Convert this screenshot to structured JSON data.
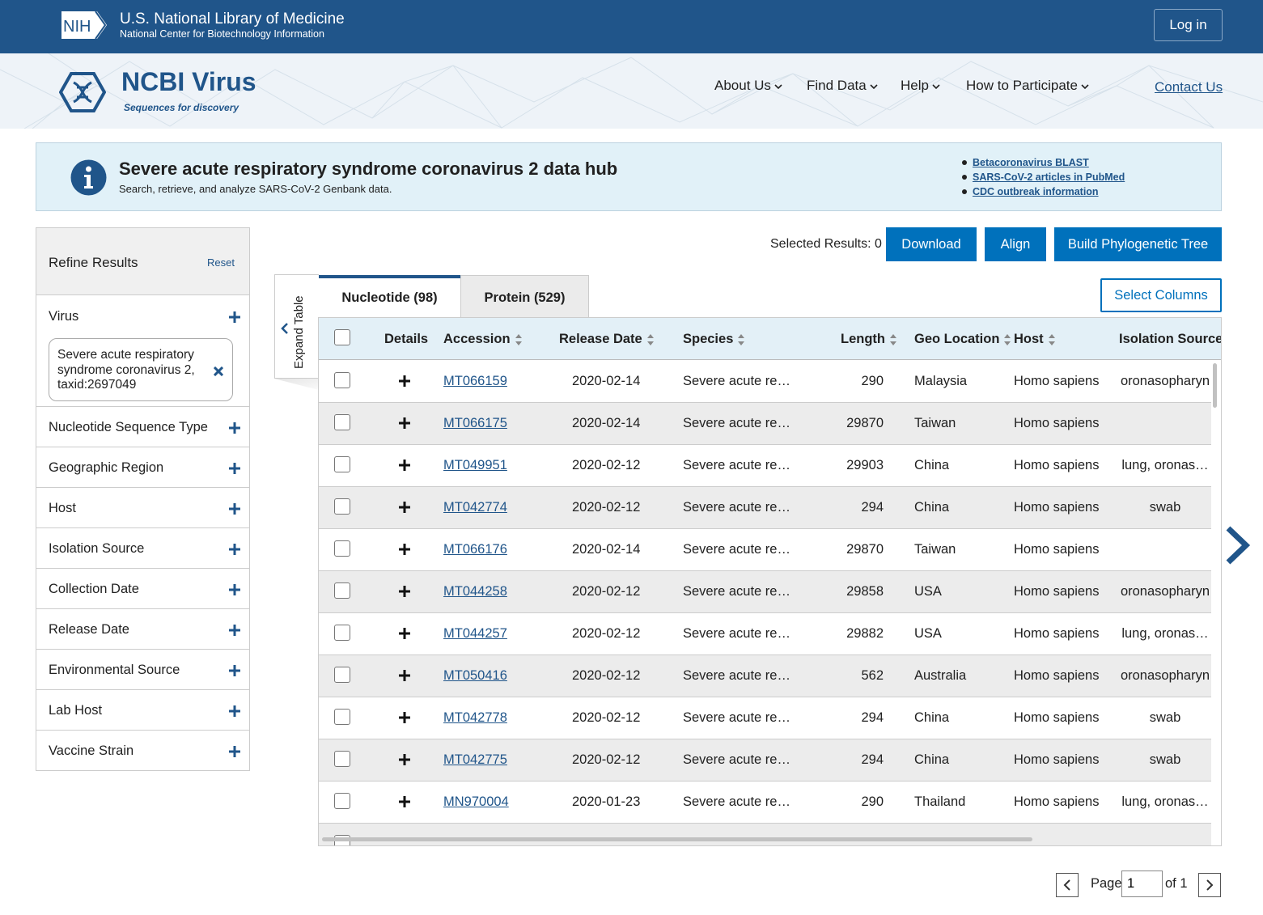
{
  "nih": {
    "logo_text": "NIH",
    "title": "U.S. National Library of Medicine",
    "subtitle": "National Center for Biotechnology Information",
    "login_label": "Log in"
  },
  "site": {
    "name": "NCBI Virus",
    "tagline": "Sequences for discovery",
    "nav": [
      "About Us",
      "Find Data",
      "Help",
      "How to Participate"
    ],
    "contact_label": "Contact Us"
  },
  "banner": {
    "title": "Severe acute respiratory syndrome coronavirus 2 data hub",
    "subtitle": "Search, retrieve, and analyze SARS-CoV-2 Genbank data.",
    "links": [
      "Betacoronavirus BLAST",
      "SARS-CoV-2 articles in PubMed",
      "CDC outbreak information"
    ]
  },
  "sidebar": {
    "title": "Refine Results",
    "reset_label": "Reset",
    "virus_label": "Virus",
    "virus_chip": "Severe acute respiratory syndrome coronavirus 2, taxid:2697049",
    "facets": [
      "Nucleotide Sequence Type",
      "Geographic Region",
      "Host",
      "Isolation Source",
      "Collection Date",
      "Release Date",
      "Environmental Source",
      "Lab Host",
      "Vaccine Strain"
    ]
  },
  "toolbar": {
    "selected_results": "Selected Results: 0",
    "download_label": "Download",
    "align_label": "Align",
    "tree_label": "Build Phylogenetic Tree",
    "select_columns_label": "Select Columns",
    "expand_table_label": "Expand Table"
  },
  "tabs": [
    {
      "label": "Nucleotide (98)",
      "active": true
    },
    {
      "label": "Protein (529)",
      "active": false
    }
  ],
  "table": {
    "columns": [
      "Details",
      "Accession",
      "Release Date",
      "Species",
      "Length",
      "Geo Location",
      "Host",
      "Isolation Source"
    ],
    "rows": [
      {
        "accession": "MT066159",
        "release_date": "2020-02-14",
        "species": "Severe acute re…",
        "length": "290",
        "geo": "Malaysia",
        "host": "Homo sapiens",
        "isolation": "oronasopharyn"
      },
      {
        "accession": "MT066175",
        "release_date": "2020-02-14",
        "species": "Severe acute re…",
        "length": "29870",
        "geo": "Taiwan",
        "host": "Homo sapiens",
        "isolation": ""
      },
      {
        "accession": "MT049951",
        "release_date": "2020-02-12",
        "species": "Severe acute re…",
        "length": "29903",
        "geo": "China",
        "host": "Homo sapiens",
        "isolation": "lung, oronas…"
      },
      {
        "accession": "MT042774",
        "release_date": "2020-02-12",
        "species": "Severe acute re…",
        "length": "294",
        "geo": "China",
        "host": "Homo sapiens",
        "isolation": "swab"
      },
      {
        "accession": "MT066176",
        "release_date": "2020-02-14",
        "species": "Severe acute re…",
        "length": "29870",
        "geo": "Taiwan",
        "host": "Homo sapiens",
        "isolation": ""
      },
      {
        "accession": "MT044258",
        "release_date": "2020-02-12",
        "species": "Severe acute re…",
        "length": "29858",
        "geo": "USA",
        "host": "Homo sapiens",
        "isolation": "oronasopharyn"
      },
      {
        "accession": "MT044257",
        "release_date": "2020-02-12",
        "species": "Severe acute re…",
        "length": "29882",
        "geo": "USA",
        "host": "Homo sapiens",
        "isolation": "lung, oronas…"
      },
      {
        "accession": "MT050416",
        "release_date": "2020-02-12",
        "species": "Severe acute re…",
        "length": "562",
        "geo": "Australia",
        "host": "Homo sapiens",
        "isolation": "oronasopharyn"
      },
      {
        "accession": "MT042778",
        "release_date": "2020-02-12",
        "species": "Severe acute re…",
        "length": "294",
        "geo": "China",
        "host": "Homo sapiens",
        "isolation": "swab"
      },
      {
        "accession": "MT042775",
        "release_date": "2020-02-12",
        "species": "Severe acute re…",
        "length": "294",
        "geo": "China",
        "host": "Homo sapiens",
        "isolation": "swab"
      },
      {
        "accession": "MN970004",
        "release_date": "2020-01-23",
        "species": "Severe acute re…",
        "length": "290",
        "geo": "Thailand",
        "host": "Homo sapiens",
        "isolation": "lung, oronas…"
      }
    ]
  },
  "pagination": {
    "page_label": "Page",
    "page_value": "1",
    "of_label": "of 1"
  },
  "colors": {
    "brand_blue": "#20558a",
    "button_blue": "#0071bc",
    "banner_bg": "#e1f1f8",
    "table_header_bg": "#e3f0f7"
  }
}
